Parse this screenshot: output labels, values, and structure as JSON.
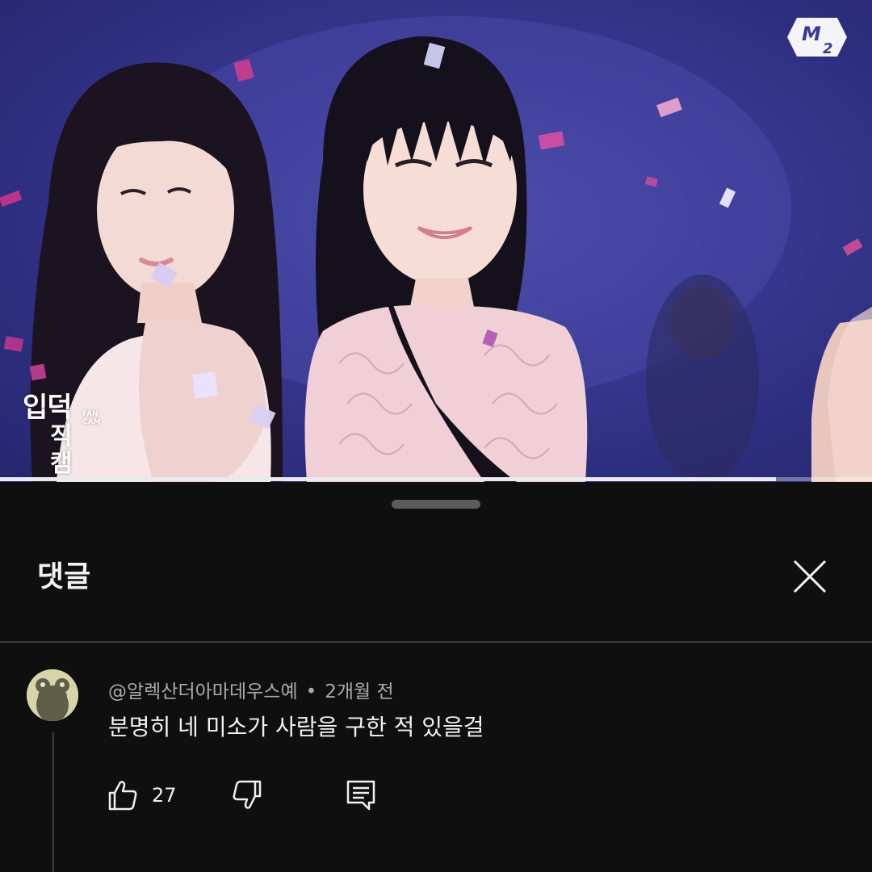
{
  "video": {
    "channel_logo": "m2-logo",
    "watermark_line1": "입덕",
    "watermark_line2": "직캠",
    "watermark_badge": "FAN CAM",
    "progress": 0.89
  },
  "sheet": {
    "title": "댓글",
    "close_icon": "close-icon"
  },
  "comments": [
    {
      "author": "@알렉산더아마데우스예",
      "separator": "•",
      "time": "2개월 전",
      "text": "분명히 네 미소가 사람을 구한 적 있을걸",
      "like_count": "27",
      "icons": [
        "thumbs-up-icon",
        "thumbs-down-icon",
        "reply-icon"
      ]
    }
  ],
  "colors": {
    "background": "#0f0f0f",
    "text_primary": "#f1f1f1",
    "text_secondary": "#aaaaaa",
    "divider": "#3b3b3b",
    "handle": "#5b5b5b",
    "video_bg": "#3a3a94"
  }
}
